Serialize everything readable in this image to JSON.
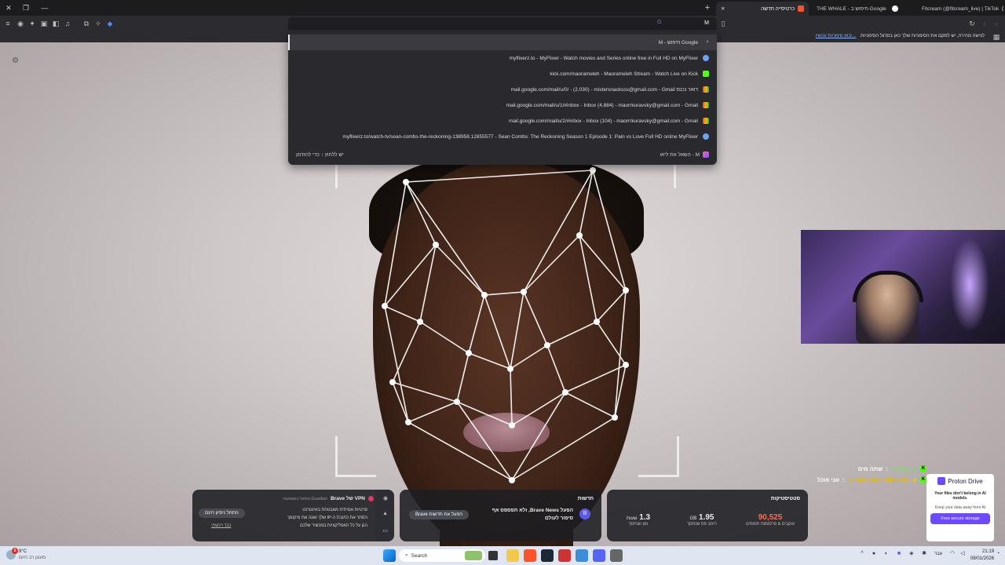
{
  "tabs": [
    {
      "title": "כרטיסייה חדשה",
      "active": true
    },
    {
      "title": "THE WHALE - חיפוש ב-Google",
      "active": false
    },
    {
      "title": "Fitcream (@fitcream_live) | TikTok",
      "active": false
    }
  ],
  "omnibox": {
    "typed": "M",
    "suggestions": [
      {
        "text": "M - חיפוש Google",
        "icon": "search-icon",
        "selected": true
      },
      {
        "text": "myflixerz.to - MyFlixer - Watch movies and Series online free in Full HD on MyFlixer",
        "icon": "globe-icon"
      },
      {
        "text": "kick.com/maorameleh - Maorameleh Stream - Watch Live on Kick",
        "icon": "kick-icon"
      },
      {
        "text": "mail.google.com/mail/u/0/ - (2,030) - mistersnacksss@gmail.com - Gmail דואר נכנס",
        "icon": "gmail-icon"
      },
      {
        "text": "mail.google.com/mail/u/1/#inbox - Inbox (4,884) - maorrkuravsky@gmail.com - Gmail",
        "icon": "gmail-icon"
      },
      {
        "text": "mail.google.com/mail/u/2/#inbox - Inbox (104) - maorrrkuravsky@gmail.com - Gmail",
        "icon": "gmail-icon"
      },
      {
        "text": "myflixerz.to/watch-tv/sean-combs-the-reckoning-138958.12855577 - Sean Combs: The Reckoning Season 1 Episode 1: Pain vs Love Full HD online MyFlixer",
        "icon": "globe-icon"
      }
    ],
    "footer_left": "יש ללחוץ ↑ כדי להזדמן",
    "footer_right": "M - השאל את ליאו"
  },
  "bookmarks_bar": {
    "notice": "לגישה מהירה, יש למקם את הסימניות שלך כאן בסרגל הסימניות.",
    "import_link": "...יבוא סימניות עכשיו"
  },
  "chat": [
    {
      "user": "Dstroy_D",
      "message": "שתה מים"
    },
    {
      "user": "Triumphomersimpson",
      "message": "אני אוכל"
    }
  ],
  "proton": {
    "brand": "Proton Drive",
    "headline": "Your files don't belong in AI models.",
    "sub": "Keep your data away from AI",
    "button": "Free secure storage"
  },
  "widgets": {
    "stats": {
      "title": "סטטיסטיקות",
      "trackers_value": "90,525",
      "trackers_label": "עוקבים & פרסומות חסומים",
      "bandwidth_value": "1.95",
      "bandwidth_unit": "GB",
      "bandwidth_label": "רוחב פס שנחסך",
      "time_value": "1.3",
      "time_unit": "שעות",
      "time_label": "זמן שנחסך",
      "accent": "#ff6a4d"
    },
    "news": {
      "title": "חדשות",
      "body": "הפעל Brave News, ולא תפספס אף סיפור לעולם",
      "button": "הפעל את חדשות Brave"
    },
    "vpn": {
      "title": "VPN של Brave",
      "badge": "Guardian מופעל באמצעות",
      "features": [
        "פרטיות אמיתית מאבטחת באינטרנט",
        "הסתר את כתובת ה-IP שלך ושנה את מיקומך",
        "הגן על כל האפליקציות במכשיר שלכם"
      ],
      "trial_button": "התחל ניסיון חינם",
      "already_purchased": "כבר רכשתי"
    }
  },
  "taskbar": {
    "weather_temp": "9°C",
    "weather_desc": "מעונן רב היום",
    "search_placeholder": "Search",
    "time": "21:19",
    "date": "08/01/2026",
    "lang": "עבר",
    "notification_count": "8"
  }
}
